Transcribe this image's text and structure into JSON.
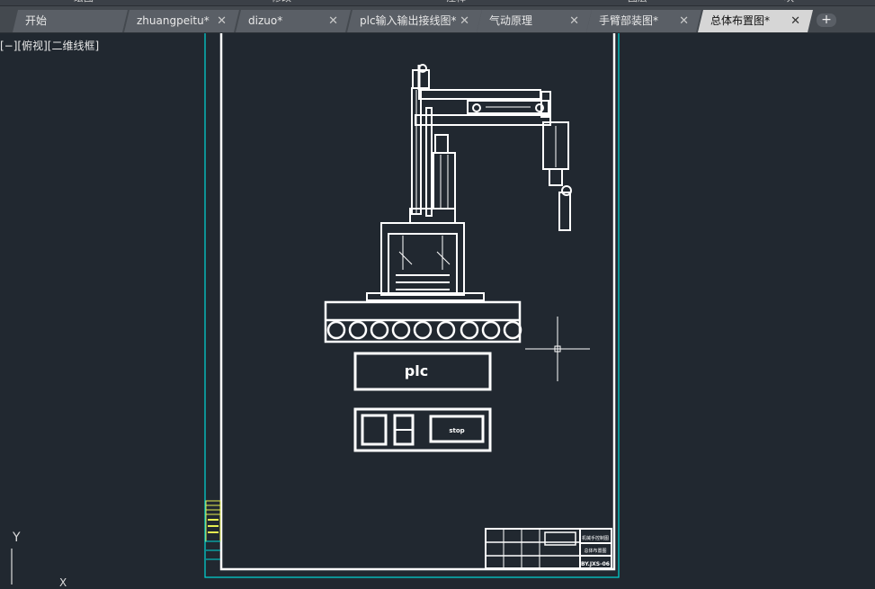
{
  "ribbon": {
    "labels": [
      "绘图",
      "修改",
      "注释",
      "图层",
      "块"
    ]
  },
  "tabs": [
    {
      "label": "开始",
      "closable": false,
      "active": false
    },
    {
      "label": "zhuangpeitu*",
      "closable": true,
      "active": false
    },
    {
      "label": "dizuo*",
      "closable": true,
      "active": false
    },
    {
      "label": "plc输入输出接线图*",
      "closable": true,
      "active": false
    },
    {
      "label": "气动原理",
      "closable": true,
      "active": false
    },
    {
      "label": "手臂部装图*",
      "closable": true,
      "active": false
    },
    {
      "label": "总体布置图*",
      "closable": true,
      "active": true
    }
  ],
  "close_glyph": "✕",
  "new_tab_glyph": "+",
  "viewport": {
    "label": "[−][俯视][二维线框]"
  },
  "drawing": {
    "plc_label": "plc",
    "stop_label": "stop",
    "title_block": {
      "row1": "机械手控制图",
      "row2": "总体布置图",
      "row3": "BY.JXS-06"
    },
    "colors": {
      "background": "#212830",
      "lines": "#ffffff",
      "border": "#00d8d8",
      "highlight": "#e6ee50"
    }
  },
  "ucs": {
    "y_label": "Y",
    "x_label": "X"
  }
}
